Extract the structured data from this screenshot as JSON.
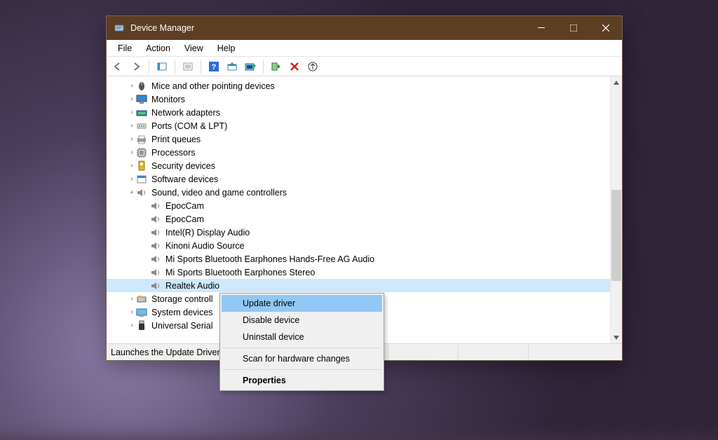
{
  "title": "Device Manager",
  "menus": {
    "file": "File",
    "action": "Action",
    "view": "View",
    "help": "Help"
  },
  "categories": {
    "mice": "Mice and other pointing devices",
    "monitors": "Monitors",
    "network": "Network adapters",
    "ports": "Ports (COM & LPT)",
    "print": "Print queues",
    "processors": "Processors",
    "security": "Security devices",
    "software": "Software devices",
    "sound": "Sound, video and game controllers",
    "storage": "Storage controll",
    "system": "System devices",
    "usb": "Universal Serial "
  },
  "sound_devices": [
    "EpocCam",
    "EpocCam",
    "Intel(R) Display Audio",
    "Kinoni Audio Source",
    "Mi Sports Bluetooth Earphones Hands-Free AG Audio",
    "Mi Sports Bluetooth Earphones Stereo",
    "Realtek Audio"
  ],
  "context_menu": {
    "update": "Update driver",
    "disable": "Disable device",
    "uninstall": "Uninstall device",
    "scan": "Scan for hardware changes",
    "props": "Properties"
  },
  "status_text": "Launches the Update Driver"
}
